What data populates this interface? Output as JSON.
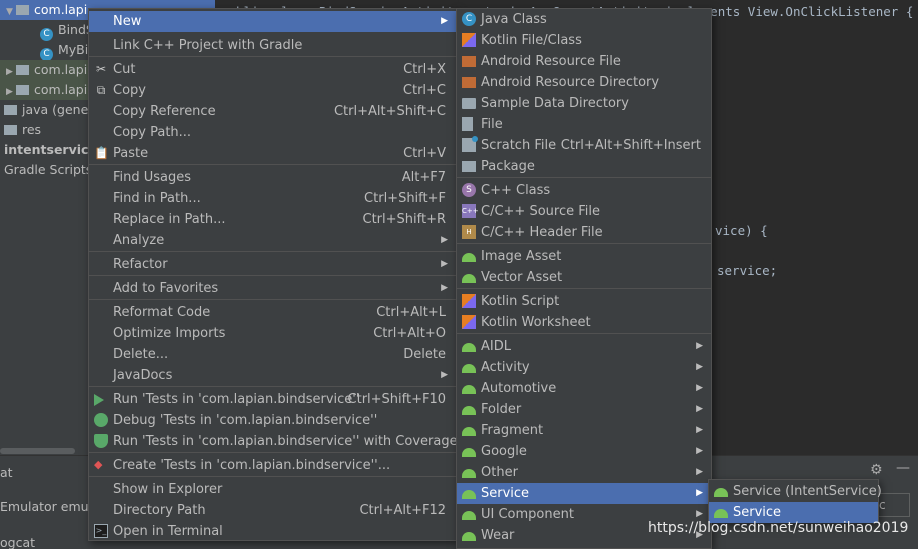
{
  "project_tree": {
    "rows": [
      {
        "label": "com.lapi",
        "selected": true
      },
      {
        "label": "BindS"
      },
      {
        "label": "MyBi"
      },
      {
        "label": "com.lapi"
      },
      {
        "label": "com.lapi"
      },
      {
        "label": "java (gener"
      },
      {
        "label": "res"
      },
      {
        "label": "intentservice"
      },
      {
        "label": "Gradle Scripts"
      }
    ]
  },
  "editor": {
    "line1": "public class BindServiceActivity extends AppCompatActivity implements View.OnClickListener {",
    "frag1": "vice) {",
    "frag2": "service;"
  },
  "bottom": {
    "tab_text": "at",
    "emulator": "Emulator emula",
    "logcat": "ogcat",
    "combo_value": "c"
  },
  "watermark": "https://blog.csdn.net/sunweihao2019",
  "context_menu": {
    "items": [
      {
        "label": "New",
        "shortcut": "",
        "has_submenu": true,
        "selected": true,
        "icon": ""
      },
      {
        "label": "Link C++ Project with Gradle",
        "shortcut": "",
        "icon": ""
      },
      {
        "label": "Cut",
        "shortcut": "Ctrl+X",
        "icon": "scissors-icon"
      },
      {
        "label": "Copy",
        "shortcut": "Ctrl+C",
        "icon": "copy-icon"
      },
      {
        "label": "Copy Reference",
        "shortcut": "Ctrl+Alt+Shift+C",
        "icon": ""
      },
      {
        "label": "Copy Path...",
        "shortcut": "",
        "icon": ""
      },
      {
        "label": "Paste",
        "shortcut": "Ctrl+V",
        "icon": "paste-icon"
      },
      {
        "label": "Find Usages",
        "shortcut": "Alt+F7",
        "icon": ""
      },
      {
        "label": "Find in Path...",
        "shortcut": "Ctrl+Shift+F",
        "icon": ""
      },
      {
        "label": "Replace in Path...",
        "shortcut": "Ctrl+Shift+R",
        "icon": ""
      },
      {
        "label": "Analyze",
        "shortcut": "",
        "has_submenu": true,
        "icon": ""
      },
      {
        "label": "Refactor",
        "shortcut": "",
        "has_submenu": true,
        "icon": ""
      },
      {
        "label": "Add to Favorites",
        "shortcut": "",
        "has_submenu": true,
        "icon": ""
      },
      {
        "label": "Reformat Code",
        "shortcut": "Ctrl+Alt+L",
        "icon": ""
      },
      {
        "label": "Optimize Imports",
        "shortcut": "Ctrl+Alt+O",
        "icon": ""
      },
      {
        "label": "Delete...",
        "shortcut": "Delete",
        "icon": ""
      },
      {
        "label": "JavaDocs",
        "shortcut": "",
        "has_submenu": true,
        "icon": ""
      },
      {
        "label": "Run 'Tests in 'com.lapian.bindservice''",
        "shortcut": "Ctrl+Shift+F10",
        "icon": "run-icon"
      },
      {
        "label": "Debug 'Tests in 'com.lapian.bindservice''",
        "shortcut": "",
        "icon": "debug-icon"
      },
      {
        "label": "Run 'Tests in 'com.lapian.bindservice'' with Coverage",
        "shortcut": "",
        "icon": "coverage-icon"
      },
      {
        "label": "Create 'Tests in 'com.lapian.bindservice''...",
        "shortcut": "",
        "icon": "create-test-icon"
      },
      {
        "label": "Show in Explorer",
        "shortcut": "",
        "icon": ""
      },
      {
        "label": "Directory Path",
        "shortcut": "Ctrl+Alt+F12",
        "icon": ""
      },
      {
        "label": "Open in Terminal",
        "shortcut": "",
        "icon": "terminal-icon"
      }
    ]
  },
  "new_submenu": {
    "items": [
      {
        "label": "Java Class",
        "shortcut": "",
        "icon": "java-class-icon"
      },
      {
        "label": "Kotlin File/Class",
        "shortcut": "",
        "icon": "kotlin-icon"
      },
      {
        "label": "Android Resource File",
        "shortcut": "",
        "icon": "resource-file-icon"
      },
      {
        "label": "Android Resource Directory",
        "shortcut": "",
        "icon": "resource-dir-icon"
      },
      {
        "label": "Sample Data Directory",
        "shortcut": "",
        "icon": "folder-icon"
      },
      {
        "label": "File",
        "shortcut": "",
        "icon": "file-icon"
      },
      {
        "label": "Scratch File",
        "shortcut": "Ctrl+Alt+Shift+Insert",
        "icon": "scratch-file-icon"
      },
      {
        "label": "Package",
        "shortcut": "",
        "icon": "package-icon"
      },
      {
        "label": "C++ Class",
        "shortcut": "",
        "icon": "cpp-class-icon"
      },
      {
        "label": "C/C++ Source File",
        "shortcut": "",
        "icon": "cpp-source-icon"
      },
      {
        "label": "C/C++ Header File",
        "shortcut": "",
        "icon": "cpp-header-icon"
      },
      {
        "label": "Image Asset",
        "shortcut": "",
        "icon": "android-icon"
      },
      {
        "label": "Vector Asset",
        "shortcut": "",
        "icon": "android-icon"
      },
      {
        "label": "Kotlin Script",
        "shortcut": "",
        "icon": "kotlin-icon"
      },
      {
        "label": "Kotlin Worksheet",
        "shortcut": "",
        "icon": "kotlin-icon"
      },
      {
        "label": "AIDL",
        "has_submenu": true,
        "icon": "android-icon"
      },
      {
        "label": "Activity",
        "has_submenu": true,
        "icon": "android-icon"
      },
      {
        "label": "Automotive",
        "has_submenu": true,
        "icon": "android-icon"
      },
      {
        "label": "Folder",
        "has_submenu": true,
        "icon": "android-icon"
      },
      {
        "label": "Fragment",
        "has_submenu": true,
        "icon": "android-icon"
      },
      {
        "label": "Google",
        "has_submenu": true,
        "icon": "android-icon"
      },
      {
        "label": "Other",
        "has_submenu": true,
        "icon": "android-icon"
      },
      {
        "label": "Service",
        "has_submenu": true,
        "selected": true,
        "icon": "android-icon"
      },
      {
        "label": "UI Component",
        "has_submenu": true,
        "icon": "android-icon"
      },
      {
        "label": "Wear",
        "has_submenu": true,
        "icon": "android-icon"
      }
    ]
  },
  "service_submenu": {
    "items": [
      {
        "label": "Service (IntentService)",
        "icon": "android-icon"
      },
      {
        "label": "Service",
        "selected": true,
        "icon": "android-icon"
      }
    ]
  },
  "colors": {
    "selection": "#4b6eaf",
    "menu_bg": "#3c3f41",
    "android_green": "#78c257"
  }
}
